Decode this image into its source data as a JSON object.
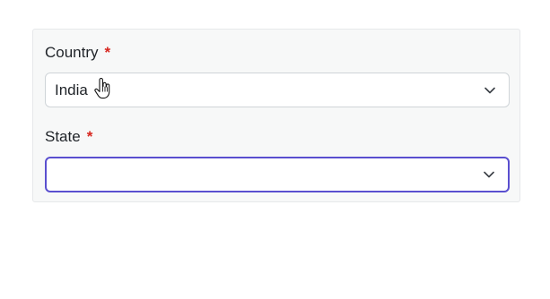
{
  "form": {
    "country": {
      "label": "Country",
      "required_marker": "*",
      "value": "India"
    },
    "state": {
      "label": "State",
      "required_marker": "*",
      "value": ""
    }
  },
  "icons": {
    "dropdown": "chevron-down-icon",
    "pointer": "hand-pointer-cursor-icon"
  },
  "colors": {
    "required": "#d7261e",
    "focus_border": "#5a4fcf",
    "panel_bg": "#f7f8f8"
  }
}
